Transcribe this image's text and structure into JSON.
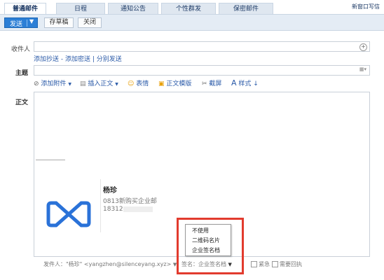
{
  "tabs": [
    {
      "label": "普通邮件",
      "active": true
    },
    {
      "label": "日程",
      "active": false
    },
    {
      "label": "通知公告",
      "active": false
    },
    {
      "label": "个性群发",
      "active": false
    },
    {
      "label": "保密邮件",
      "active": false
    }
  ],
  "top_right_link": "新窗口写信",
  "toolbar": {
    "send_label": "发送",
    "draft_label": "存草稿",
    "close_label": "关闭"
  },
  "form": {
    "recipient_label": "收件人",
    "recipient_value": "",
    "cc_links": [
      "添加抄送",
      "添加密送",
      "分别发送"
    ],
    "subject_label": "主题",
    "subject_value": "",
    "body_label": "正文"
  },
  "format_bar": {
    "attach": "添加附件",
    "insert_body": "插入正文",
    "emoji": "表情",
    "template": "正文模版",
    "screenshot": "截屏",
    "style": "样式"
  },
  "signature": {
    "name": "杨珍",
    "company": "0813新购买企业邮",
    "phone": "18312"
  },
  "footer": {
    "sender_label": "发件人：",
    "sender_value": "\"杨珍\" <yangzhen@silenceyang.xyz>",
    "signature_label": "签名：企业签名档",
    "urgent": "紧急",
    "receipt": "需要回执"
  },
  "signature_dropdown": [
    "不使用",
    "二维码名片",
    "企业签名档"
  ],
  "colors": {
    "accent": "#2c7fd6",
    "highlight_box": "#e23b2e",
    "logo": "#2a72d8"
  }
}
